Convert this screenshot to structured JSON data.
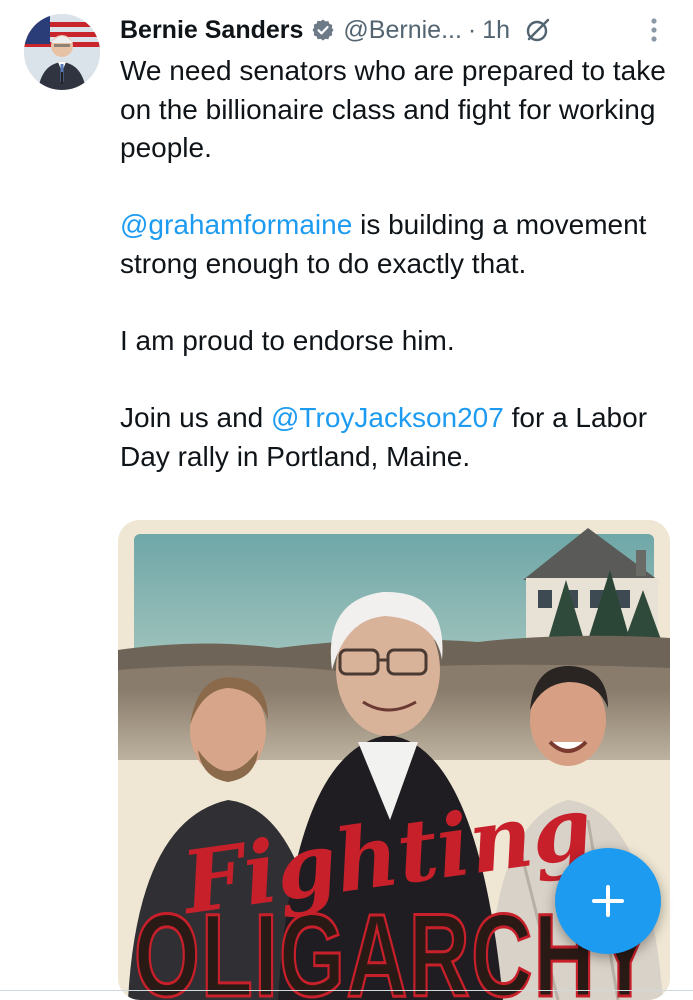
{
  "tweet": {
    "author_name": "Bernie Sanders",
    "author_handle": "@Bernie...",
    "separator": "·",
    "time": "1h",
    "paragraphs": [
      {
        "text": "We need senators who are prepared to take on the billionaire class and fight for working people."
      },
      {
        "mention": "@grahamformaine",
        "text_after": " is building a movement strong enough to do exactly that."
      },
      {
        "text": "I am proud to endorse him."
      },
      {
        "text_before": "Join us and ",
        "mention": "@TroyJackson207",
        "text_after": " for a Labor Day rally in Portland, Maine."
      }
    ]
  },
  "media": {
    "title_script": "Fighting",
    "title_block": "OLIGARCHY",
    "colors": {
      "script": "#c8202a",
      "block": "#2a1a16",
      "sky": "#7fb3b3"
    }
  },
  "icons": {
    "verified": "verified-badge-icon",
    "grok": "grok-icon",
    "more": "more-vertical-icon",
    "compose": "plus-icon"
  },
  "colors": {
    "accent": "#1d9bf0",
    "text": "#0f1419",
    "muted": "#536471"
  }
}
